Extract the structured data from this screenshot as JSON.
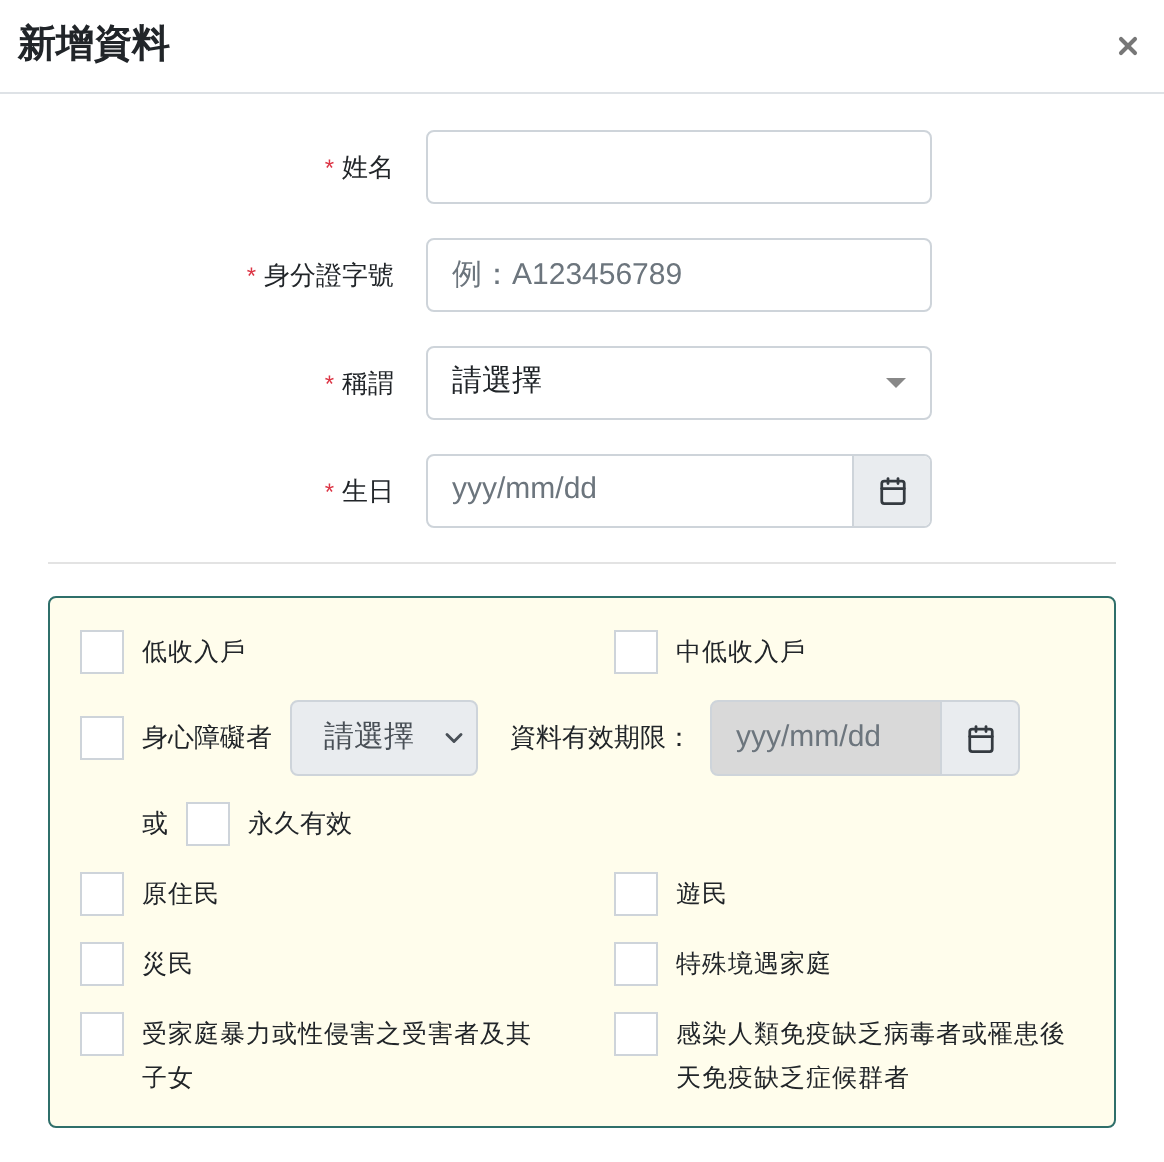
{
  "dialog": {
    "title": "新增資料"
  },
  "fields": [
    {
      "kind": "text",
      "label": "姓名",
      "required_mark": "*"
    },
    {
      "kind": "text",
      "label": "身分證字號",
      "required_mark": "*",
      "placeholder": "例：A123456789"
    },
    {
      "kind": "select",
      "label": "稱謂",
      "required_mark": "*",
      "value": "請選擇"
    },
    {
      "kind": "date",
      "label": "生日",
      "required_mark": "*",
      "placeholder": "yyy/mm/dd"
    }
  ],
  "categories": [
    {
      "kind": "checkbox",
      "label": "低收入戶",
      "checked": false
    },
    {
      "kind": "checkbox",
      "label": "中低收入戶",
      "checked": false
    },
    {
      "kind": "disability",
      "label": "身心障礙者",
      "checked": false,
      "select": "請選擇",
      "expiry_label": "資料有效期限：",
      "expiry_placeholder": "yyy/mm/dd",
      "or_label": "或",
      "permanent_label": "永久有效",
      "permanent_checked": false
    },
    {
      "kind": "checkbox",
      "label": "原住民",
      "checked": false
    },
    {
      "kind": "checkbox",
      "label": "遊民",
      "checked": false
    },
    {
      "kind": "checkbox",
      "label": "災民",
      "checked": false
    },
    {
      "kind": "checkbox",
      "label": "特殊境遇家庭",
      "checked": false
    },
    {
      "kind": "checkbox",
      "label": "受家庭暴力或性侵害之受害者及其子女",
      "checked": false
    },
    {
      "kind": "checkbox",
      "label": "感染人類免疫缺乏病毒者或罹患後天免疫缺乏症候群者",
      "checked": false
    }
  ]
}
